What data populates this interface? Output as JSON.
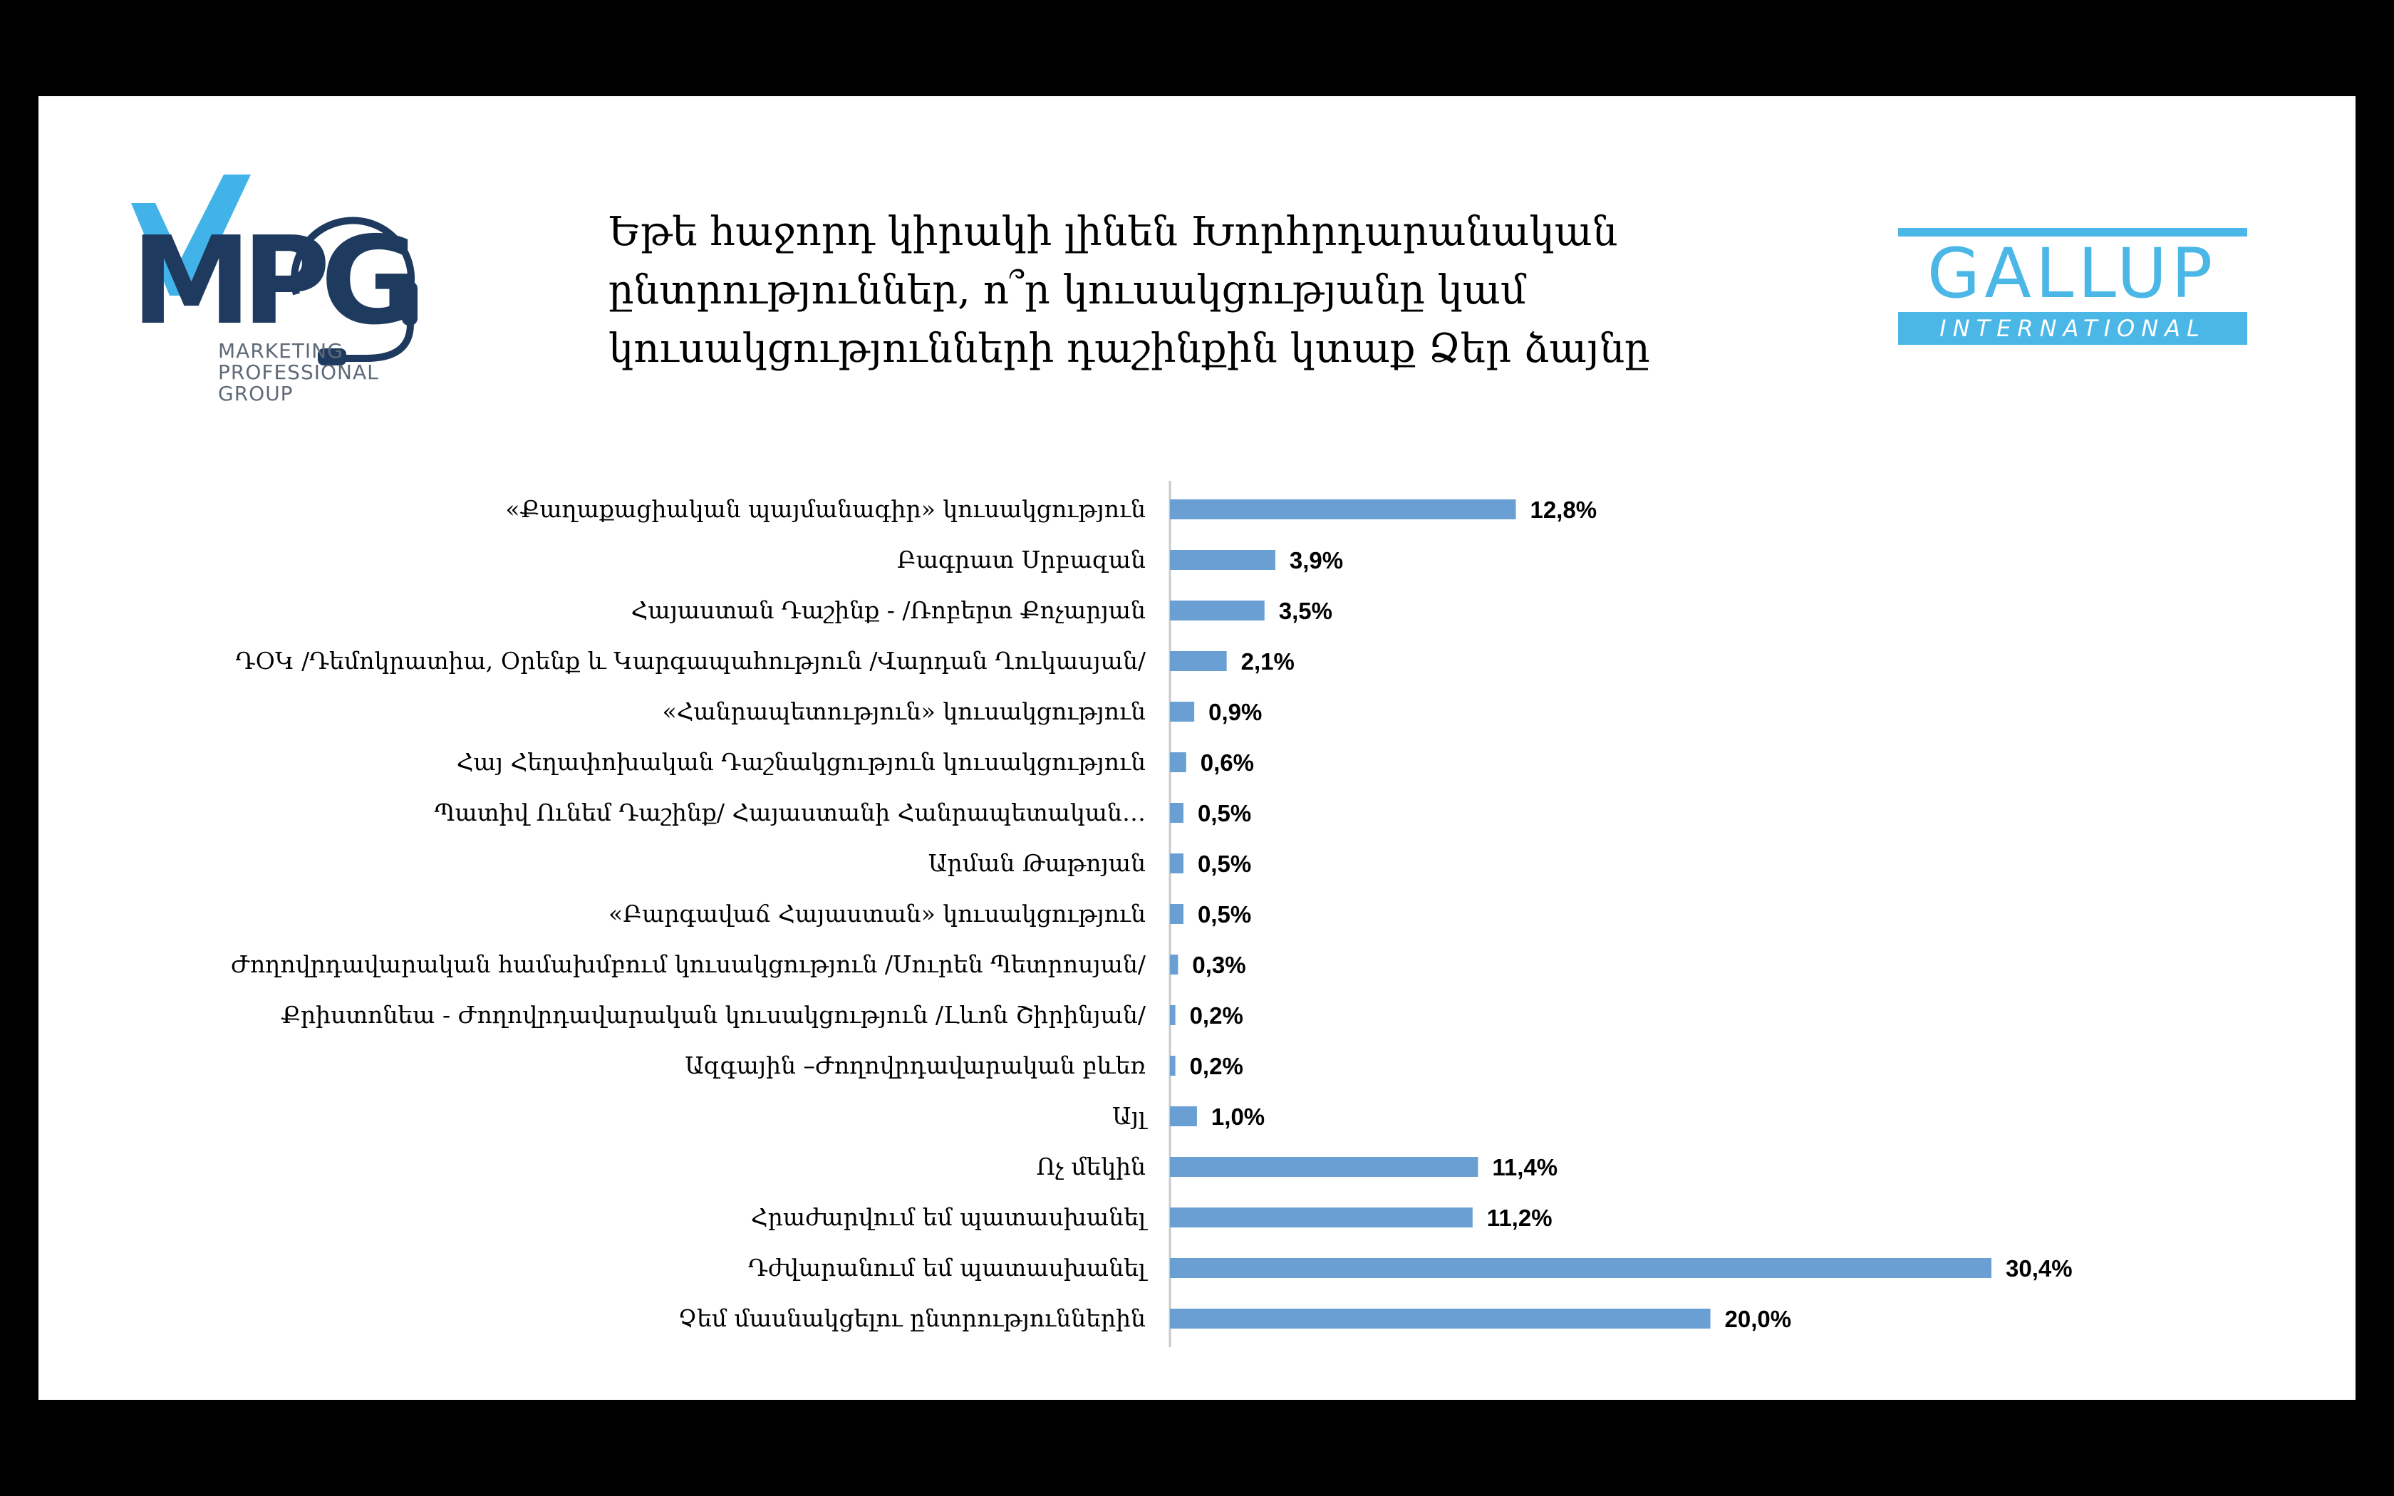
{
  "colors": {
    "page_background": "#000000",
    "slide_background": "#ffffff",
    "bar": "#6a9fd4",
    "axis": "#c8c8c8",
    "mpg_dark": "#1f3a5f",
    "mpg_light": "#41b3e8",
    "gallup": "#4ab7e6"
  },
  "mpg_logo": {
    "letters": "MPG",
    "caption_lines": [
      "MARKETING",
      "PROFESSIONAL",
      "GROUP"
    ]
  },
  "gallup_logo": {
    "word": "GALLUP",
    "band": "INTERNATIONAL"
  },
  "chart_data": {
    "type": "bar",
    "orientation": "horizontal",
    "title_lines": [
      "Եթե հաջորդ կիրակի լինեն Խորհրդարանական",
      "ընտրություններ, ո՞ր կուսակցությանը կամ",
      "կուսակցությունների դաշինքին կտաք Ձեր ձայնը"
    ],
    "categories": [
      "«Քաղաքացիական պայմանագիր» կուսակցություն",
      "Բագրատ Սրբազան",
      "Հայաստան Դաշինք - /Ռոբերտ Քոչարյան",
      "ԴՕԿ /Դեմոկրատիա, Օրենք և Կարգապահություն /Վարդան Ղուկասյան/",
      "«Հանրապետություն»  կուսակցություն",
      "Հայ Հեղափոխական Դաշնակցություն կուսակցություն",
      "Պատիվ Ունեմ Դաշինք/ Հայաստանի Հանրապետական…",
      "Արման Թաթոյան",
      "«Բարգավաճ Հայաստան»  կուսակցություն",
      "Ժողովրդավարական համախմբում կուսակցություն /Սուրեն Պետրոսյան/",
      "Քրիստոնեա - Ժողովրդավարական կուսակցություն /Լևոն Շիրինյան/",
      "Ազգային –Ժողովրդավարական բևեռ",
      "Այլ",
      "Ոչ մեկին",
      "Հրաժարվում եմ պատասխանել",
      "Դժվարանում եմ պատասխանել",
      "Չեմ մասնակցելու ընտրություններին"
    ],
    "values": [
      12.8,
      3.9,
      3.5,
      2.1,
      0.9,
      0.6,
      0.5,
      0.5,
      0.5,
      0.3,
      0.2,
      0.2,
      1.0,
      11.4,
      11.2,
      30.4,
      20.0
    ],
    "value_labels": [
      "12,8%",
      "3,9%",
      "3,5%",
      "2,1%",
      "0,9%",
      "0,6%",
      "0,5%",
      "0,5%",
      "0,5%",
      "0,3%",
      "0,2%",
      "0,2%",
      "1,0%",
      "11,4%",
      "11,2%",
      "30,4%",
      "20,0%"
    ],
    "xlim": [
      0,
      35
    ],
    "grid": false,
    "legend": "none"
  }
}
